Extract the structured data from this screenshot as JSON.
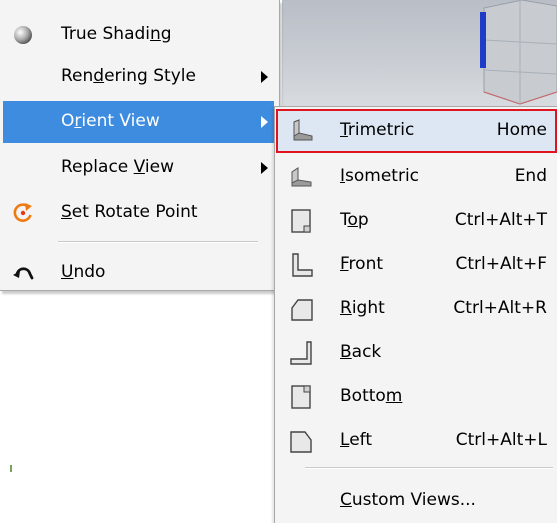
{
  "menu": {
    "items": [
      {
        "pre": "True Shadi",
        "u": "n",
        "post": "g",
        "icon": "sphere-shading-icon",
        "submenu": false
      },
      {
        "pre": "Ren",
        "u": "d",
        "post": "ering Style",
        "icon": "",
        "submenu": true
      },
      {
        "pre": "O",
        "u": "r",
        "post": "ient View",
        "icon": "",
        "submenu": true,
        "highlighted": true
      },
      {
        "pre": "Replace ",
        "u": "V",
        "post": "iew",
        "icon": "",
        "submenu": true
      },
      {
        "pre": "",
        "u": "S",
        "post": "et Rotate Point",
        "icon": "rotate-point-icon",
        "submenu": false
      },
      {
        "pre": "",
        "u": "U",
        "post": "ndo",
        "icon": "undo-icon",
        "submenu": false
      }
    ]
  },
  "orient_view_submenu": {
    "items": [
      {
        "pre": "",
        "u": "T",
        "post": "rimetric",
        "shortcut": "Home",
        "icon": "trimetric-view-icon",
        "selected": true
      },
      {
        "pre": "",
        "u": "I",
        "post": "sometric",
        "shortcut": "End",
        "icon": "isometric-view-icon"
      },
      {
        "pre": "T",
        "u": "o",
        "post": "p",
        "shortcut": "Ctrl+Alt+T",
        "icon": "top-view-icon"
      },
      {
        "pre": "",
        "u": "F",
        "post": "ront",
        "shortcut": "Ctrl+Alt+F",
        "icon": "front-view-icon"
      },
      {
        "pre": "",
        "u": "R",
        "post": "ight",
        "shortcut": "Ctrl+Alt+R",
        "icon": "right-view-icon"
      },
      {
        "pre": "",
        "u": "B",
        "post": "ack",
        "shortcut": "",
        "icon": "back-view-icon"
      },
      {
        "pre": "Botto",
        "u": "m",
        "post": "",
        "shortcut": "",
        "icon": "bottom-view-icon"
      },
      {
        "pre": "",
        "u": "L",
        "post": "eft",
        "shortcut": "Ctrl+Alt+L",
        "icon": "left-view-icon"
      },
      {
        "pre": "",
        "u": "C",
        "post": "ustom Views...",
        "shortcut": "",
        "icon": ""
      }
    ]
  },
  "colors": {
    "highlight": "#3e8ce0",
    "selected_outline": "#e0141e",
    "menu_bg": "#f4f4f4"
  }
}
